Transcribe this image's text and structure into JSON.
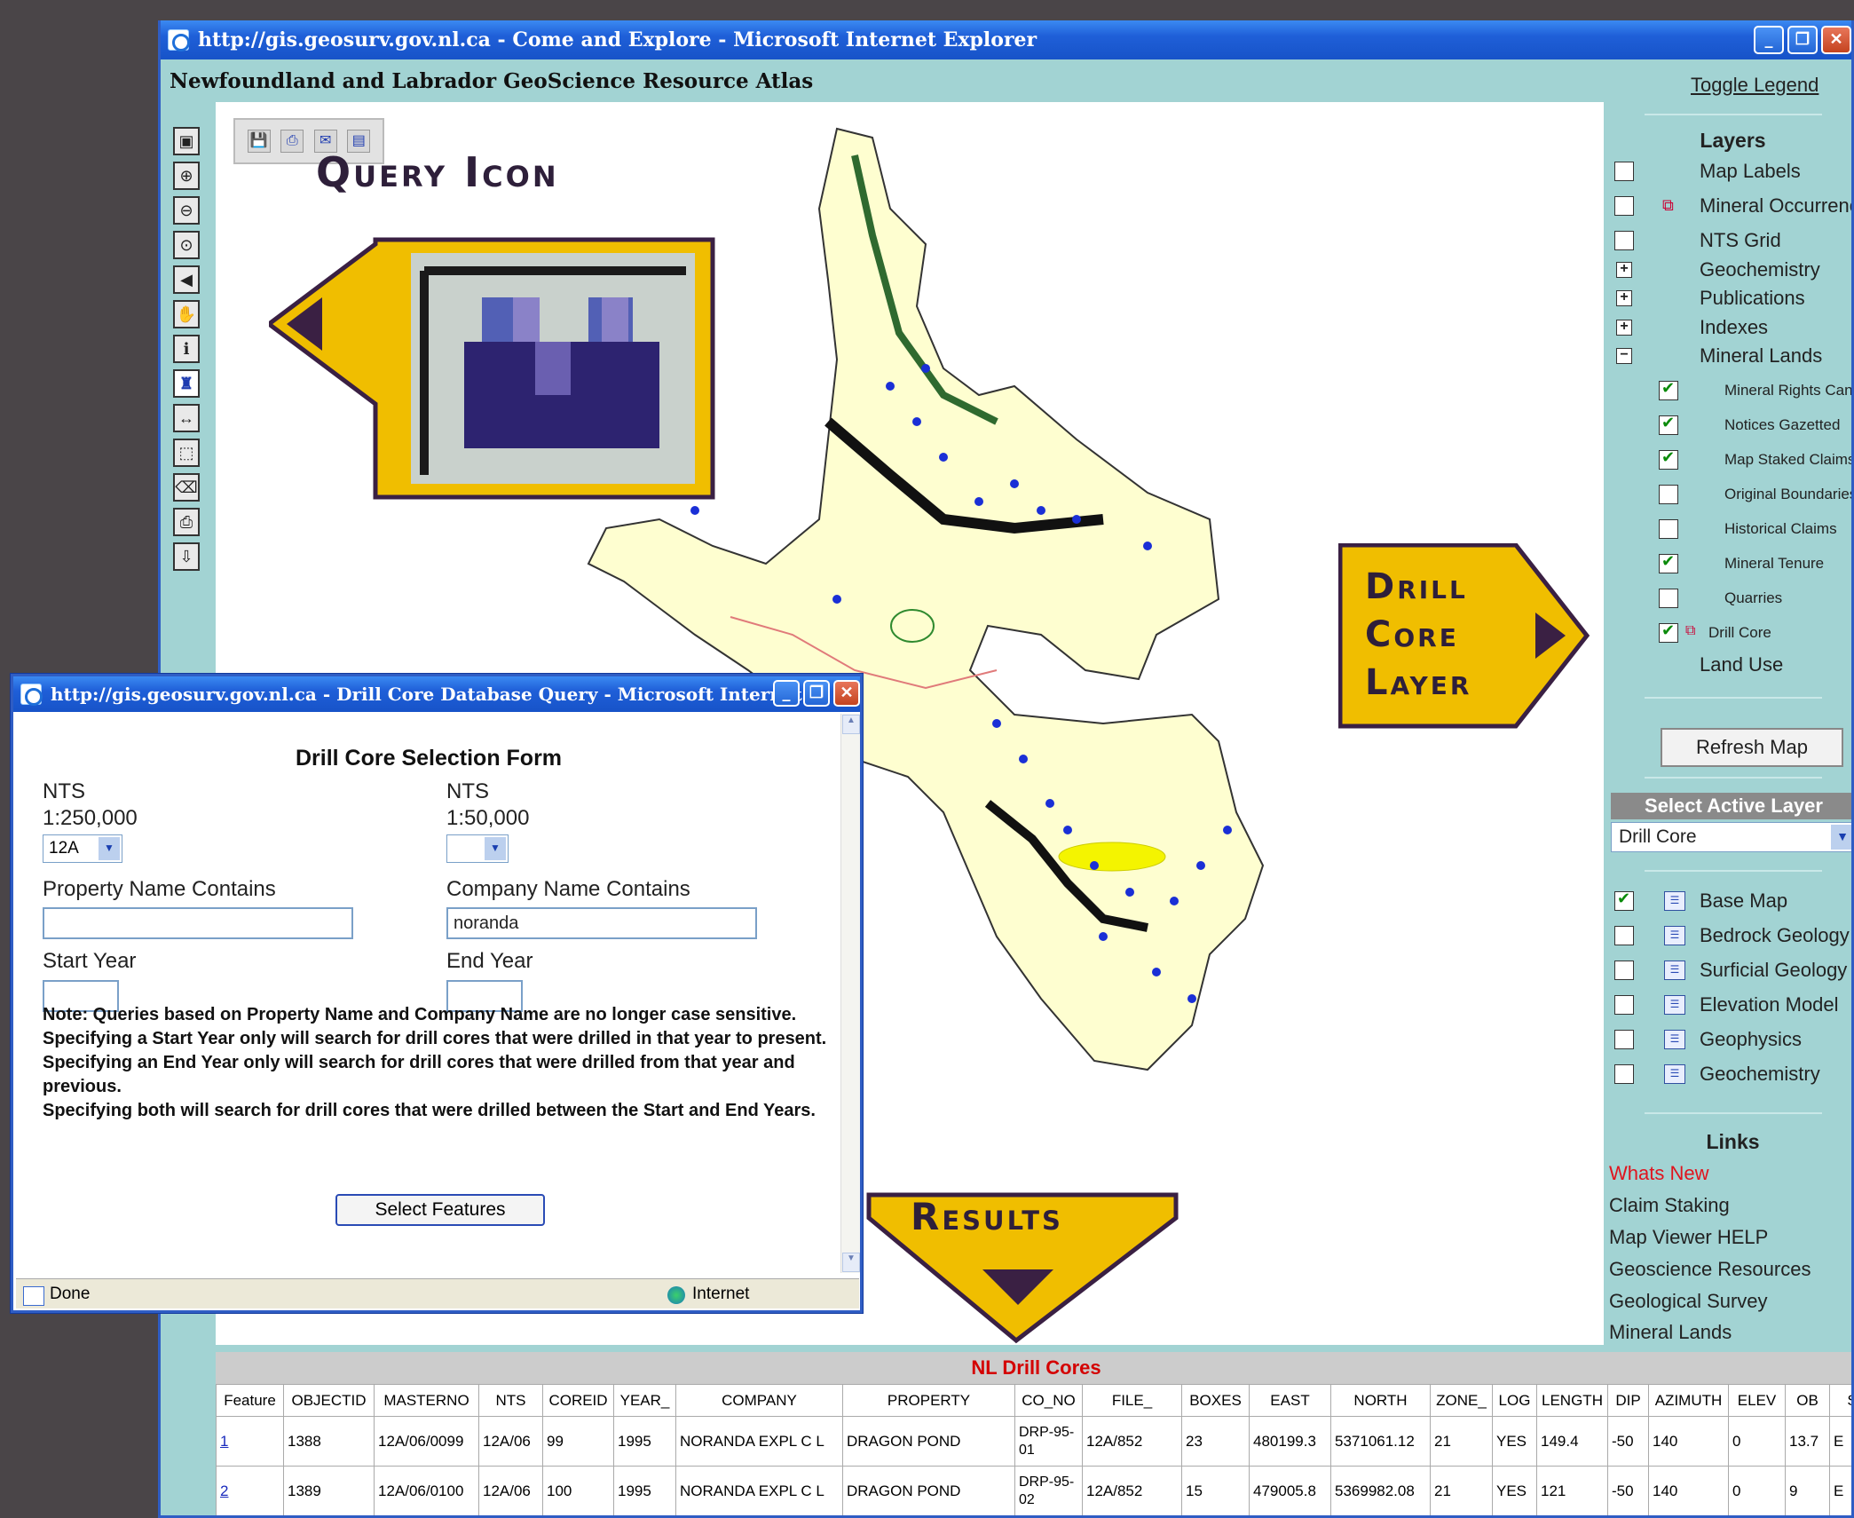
{
  "main_window": {
    "title": "http://gis.geosurv.gov.nl.ca - Come and Explore - Microsoft Internet Explorer",
    "app_header": "Newfoundland and Labrador GeoScience Resource Atlas"
  },
  "callouts": {
    "query_icon": "Query Icon",
    "drill_core_layer_1": "Drill",
    "drill_core_layer_2": "Core",
    "drill_core_layer_3": "Layer",
    "results": "Results"
  },
  "right_panel": {
    "toggle_legend": "Toggle Legend",
    "layers_heading": "Layers",
    "layers": [
      {
        "label": "Map Labels",
        "checked": false
      },
      {
        "label": "Mineral Occurrences",
        "checked": false
      },
      {
        "label": "NTS Grid",
        "checked": false
      },
      {
        "label": "Geochemistry",
        "expandable": "+"
      },
      {
        "label": "Publications",
        "expandable": "+"
      },
      {
        "label": "Indexes",
        "expandable": "+"
      },
      {
        "label": "Mineral Lands",
        "expandable": "−"
      }
    ],
    "sublayers": [
      {
        "label": "Mineral Rights Cancelled",
        "checked": true
      },
      {
        "label": "Notices Gazetted",
        "checked": true
      },
      {
        "label": "Map Staked Claims",
        "checked": true
      },
      {
        "label": "Original Boundaries",
        "checked": false
      },
      {
        "label": "Historical Claims",
        "checked": false
      },
      {
        "label": "Mineral Tenure",
        "checked": true
      },
      {
        "label": "Quarries",
        "checked": false
      },
      {
        "label": "Drill Core",
        "checked": true
      }
    ],
    "land_use": "Land Use",
    "refresh_button": "Refresh Map",
    "select_active_layer": "Select Active Layer",
    "active_layer_value": "Drill Core",
    "base_layers": [
      {
        "label": "Base Map",
        "checked": true
      },
      {
        "label": "Bedrock Geology",
        "checked": false
      },
      {
        "label": "Surficial Geology",
        "checked": false
      },
      {
        "label": "Elevation Model",
        "checked": false
      },
      {
        "label": "Geophysics",
        "checked": false
      },
      {
        "label": "Geochemistry",
        "checked": false
      }
    ],
    "links_heading": "Links",
    "links": [
      "Whats New",
      "Claim Staking",
      "Map Viewer HELP",
      "Geoscience Resources",
      "Geological Survey",
      "Mineral Lands"
    ]
  },
  "popup": {
    "title": "http://gis.geosurv.gov.nl.ca - Drill Core Database Query - Microsoft Internet",
    "form_title": "Drill Core Selection Form",
    "nts250_label_1": "NTS",
    "nts250_label_2": "1:250,000",
    "nts250_value": "12A",
    "nts50_label_1": "NTS",
    "nts50_label_2": "1:50,000",
    "nts50_value": "",
    "property_label": "Property Name Contains",
    "property_value": "",
    "company_label": "Company Name Contains",
    "company_value": "noranda",
    "start_year_label": "Start Year",
    "end_year_label": "End Year",
    "note_1": "Note: Queries based on Property Name and Company Name are no longer case sensitive.",
    "note_2": "Specifying a Start Year only will search for drill cores that were drilled in that year to present.",
    "note_3": "Specifying an End Year only will search for drill cores that were drilled from that year and previous.",
    "note_4": "Specifying both will search for drill cores that were drilled between the Start and End Years.",
    "select_button": "Select Features",
    "status_done": "Done",
    "status_zone": "Internet"
  },
  "results": {
    "title": "NL Drill Cores",
    "columns": [
      "Feature",
      "OBJECTID",
      "MASTERNO",
      "NTS",
      "COREID",
      "YEAR_",
      "COMPANY",
      "PROPERTY",
      "CO_NO",
      "FILE_",
      "BOXES",
      "EAST",
      "NORTH",
      "ZONE_",
      "LOG",
      "LENGTH",
      "DIP",
      "AZIMUTH",
      "ELEV",
      "OB",
      "S"
    ],
    "rows": [
      [
        "1",
        "1388",
        "12A/06/0099",
        "12A/06",
        "99",
        "1995",
        "NORANDA EXPL C L",
        "DRAGON POND",
        "DRP-95-01",
        "12A/852",
        "23",
        "480199.3",
        "5371061.12",
        "21",
        "YES",
        "149.4",
        "-50",
        "140",
        "0",
        "13.7",
        "E"
      ],
      [
        "2",
        "1389",
        "12A/06/0100",
        "12A/06",
        "100",
        "1995",
        "NORANDA EXPL C L",
        "DRAGON POND",
        "DRP-95-02",
        "12A/852",
        "15",
        "479005.8",
        "5369982.08",
        "21",
        "YES",
        "121",
        "-50",
        "140",
        "0",
        "9",
        "E"
      ]
    ]
  },
  "colors": {
    "callout_fill": "#f0be00",
    "callout_border": "#3a2043",
    "panel_bg": "#a2d3d3",
    "titlebar_blue": "#1f5fd8"
  }
}
